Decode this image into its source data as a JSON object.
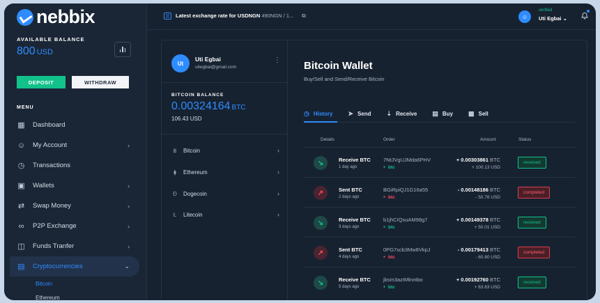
{
  "brand": {
    "name": "nebbix"
  },
  "balance": {
    "label": "AVAILABLE BALANCE",
    "amount": "800",
    "currency": "USD"
  },
  "actions": {
    "deposit": "DEPOSIT",
    "withdraw": "WITHDRAW"
  },
  "menu": {
    "label": "MENU",
    "items": [
      {
        "label": "Dashboard",
        "icon": "grid-icon",
        "chevron": ""
      },
      {
        "label": "My Account",
        "icon": "user-icon",
        "chevron": "›"
      },
      {
        "label": "Transactions",
        "icon": "clock-icon",
        "chevron": ""
      },
      {
        "label": "Wallets",
        "icon": "wallet-icon",
        "chevron": "›"
      },
      {
        "label": "Swap Money",
        "icon": "swap-icon",
        "chevron": "›"
      },
      {
        "label": "P2P Exchange",
        "icon": "link-icon",
        "chevron": "›"
      },
      {
        "label": "Funds Tranfer",
        "icon": "transfer-icon",
        "chevron": "›"
      },
      {
        "label": "Cryptocurrencies",
        "icon": "crypto-icon",
        "chevron": "⌄"
      }
    ],
    "sub_items": [
      {
        "label": "Bitcoin"
      },
      {
        "label": "Ethereum"
      }
    ]
  },
  "topbar": {
    "rate_title": "Latest exchange rate for USDNGN",
    "rate_value": "490NGN / 1...",
    "verified": "verified",
    "user": "Uti Egbai ⌄"
  },
  "profile": {
    "initials": "Ut",
    "name": "Uti Egbai",
    "email": "utiegbai@gmail.com"
  },
  "btc_balance": {
    "label": "BITCOIN BALANCE",
    "amount": "0.00324164",
    "currency": "BTC",
    "usd": "106.43 USD"
  },
  "coins": [
    {
      "symbol": "฿",
      "label": "Bitcoin"
    },
    {
      "symbol": "⧫",
      "label": "Ethereum"
    },
    {
      "symbol": "Ð",
      "label": "Dogecoin"
    },
    {
      "symbol": "Ł",
      "label": "Litecoin"
    }
  ],
  "wallet": {
    "title": "Bitcoin Wallet",
    "subtitle": "Buy/Sell and Send/Receive Bitcoin"
  },
  "tabs": [
    {
      "label": "History",
      "icon": "clock-icon"
    },
    {
      "label": "Send",
      "icon": "send-icon"
    },
    {
      "label": "Receive",
      "icon": "receive-icon"
    },
    {
      "label": "Buy",
      "icon": "wallet-icon"
    },
    {
      "label": "Sell",
      "icon": "cash-icon"
    }
  ],
  "table": {
    "headers": {
      "details": "Details",
      "order": "Order",
      "amount": "Amount",
      "status": "Status"
    },
    "rows": [
      {
        "type": "Receive BTC",
        "ago": "1 day ago",
        "order": "7NtJVgUJMda6PHV",
        "coin": "btc",
        "amount": "+ 0.00303861",
        "cur": "BTC",
        "usd": "+ 100.13 USD",
        "status": "received",
        "dir": "in"
      },
      {
        "type": "Sent BTC",
        "ago": "2 days ago",
        "order": "BGiRpiQJ1G16a55",
        "coin": "btc",
        "amount": "- 0.00148186",
        "cur": "BTC",
        "usd": "- 50.76 USD",
        "status": "completed",
        "dir": "out"
      },
      {
        "type": "Receive BTC",
        "ago": "3 days ago",
        "order": "b1jhCIQsuAM98g7",
        "coin": "btc",
        "amount": "+ 0.00149378",
        "cur": "BTC",
        "usd": "+ 50.01 USD",
        "status": "received",
        "dir": "in"
      },
      {
        "type": "Sent BTC",
        "ago": "4 days ago",
        "order": "0PG7scb3Mw8VkpJ",
        "coin": "btc",
        "amount": "- 0.00179413",
        "cur": "BTC",
        "usd": "- 60.80 USD",
        "status": "completed",
        "dir": "out"
      },
      {
        "type": "Receive BTC",
        "ago": "5 days ago",
        "order": "jbsm3azIMlnntbo",
        "coin": "btc",
        "amount": "+ 0.00192760",
        "cur": "BTC",
        "usd": "+ 63.63 USD",
        "status": "received",
        "dir": "in"
      }
    ]
  },
  "colors": {
    "accent": "#2f8cff",
    "success": "#12c28a",
    "danger": "#ff4b5c",
    "background": "#172231"
  }
}
